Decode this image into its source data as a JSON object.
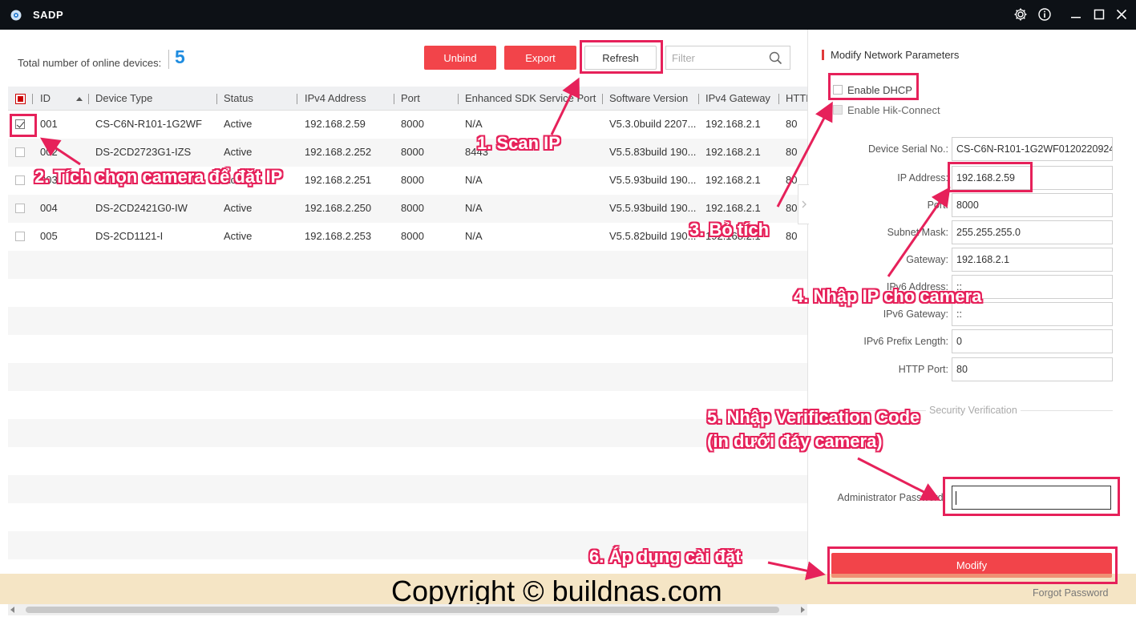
{
  "window": {
    "title": "SADP",
    "controls": [
      "gear-icon",
      "info-icon",
      "minimize-icon",
      "maximize-icon",
      "close-icon"
    ]
  },
  "toolbar": {
    "total_label": "Total number of online devices:",
    "total_count": "5",
    "unbind_label": "Unbind",
    "export_label": "Export",
    "refresh_label": "Refresh",
    "filter_placeholder": "Filter"
  },
  "table": {
    "columns": [
      "ID",
      "Device Type",
      "Status",
      "IPv4 Address",
      "Port",
      "Enhanced SDK Service Port",
      "Software Version",
      "IPv4 Gateway",
      "HTTP Port"
    ],
    "rows": [
      {
        "checked": true,
        "id": "001",
        "type": "CS-C6N-R101-1G2WF",
        "status": "Active",
        "ip": "192.168.2.59",
        "port": "8000",
        "sdk": "N/A",
        "sw": "V5.3.0build 2207...",
        "gw": "192.168.2.1",
        "http": "80"
      },
      {
        "checked": false,
        "id": "002",
        "type": "DS-2CD2723G1-IZS",
        "status": "Active",
        "ip": "192.168.2.252",
        "port": "8000",
        "sdk": "8443",
        "sw": "V5.5.83build 190...",
        "gw": "192.168.2.1",
        "http": "80"
      },
      {
        "checked": false,
        "id": "003",
        "type": "",
        "status": "Active",
        "ip": "192.168.2.251",
        "port": "8000",
        "sdk": "N/A",
        "sw": "V5.5.93build 190...",
        "gw": "192.168.2.1",
        "http": "80"
      },
      {
        "checked": false,
        "id": "004",
        "type": "DS-2CD2421G0-IW",
        "status": "Active",
        "ip": "192.168.2.250",
        "port": "8000",
        "sdk": "N/A",
        "sw": "V5.5.93build 190...",
        "gw": "192.168.2.1",
        "http": "80"
      },
      {
        "checked": false,
        "id": "005",
        "type": "DS-2CD1121-I",
        "status": "Active",
        "ip": "192.168.2.253",
        "port": "8000",
        "sdk": "N/A",
        "sw": "V5.5.82build 190...",
        "gw": "192.168.2.1",
        "http": "80"
      }
    ]
  },
  "panel": {
    "title": "Modify Network Parameters",
    "enable_dhcp": "Enable DHCP",
    "enable_hik": "Enable Hik-Connect",
    "fields": [
      {
        "label": "Device Serial No.:",
        "value": "CS-C6N-R101-1G2WF0120220924"
      },
      {
        "label": "IP Address:",
        "value": "192.168.2.59"
      },
      {
        "label": "Port:",
        "value": "8000"
      },
      {
        "label": "Subnet Mask:",
        "value": "255.255.255.0"
      },
      {
        "label": "Gateway:",
        "value": "192.168.2.1"
      },
      {
        "label": "IPv6 Address:",
        "value": "::"
      },
      {
        "label": "IPv6 Gateway:",
        "value": "::"
      },
      {
        "label": "IPv6 Prefix Length:",
        "value": "0"
      },
      {
        "label": "HTTP Port:",
        "value": "80"
      }
    ],
    "security_label": "Security Verification",
    "admin_pw_label": "Administrator Password:",
    "modify_label": "Modify",
    "forgot_label": "Forgot Password"
  },
  "annotations": {
    "step1": "1. Scan IP",
    "step2": "2. Tích chọn camera để đặt IP",
    "step3": "3. Bỏ tích",
    "step4": "4. Nhập IP cho camera",
    "step5_line1": "5. Nhập Verification Code",
    "step5_line2": "(in dưới đáy camera)",
    "step6": "6. Áp dụng cài đặt",
    "color": "#e6215a"
  },
  "watermark": "Copyright © buildnas.com",
  "colors": {
    "titlebar": "#0d1116",
    "accent_red": "#f2444a",
    "count_blue": "#1e8ce0"
  }
}
